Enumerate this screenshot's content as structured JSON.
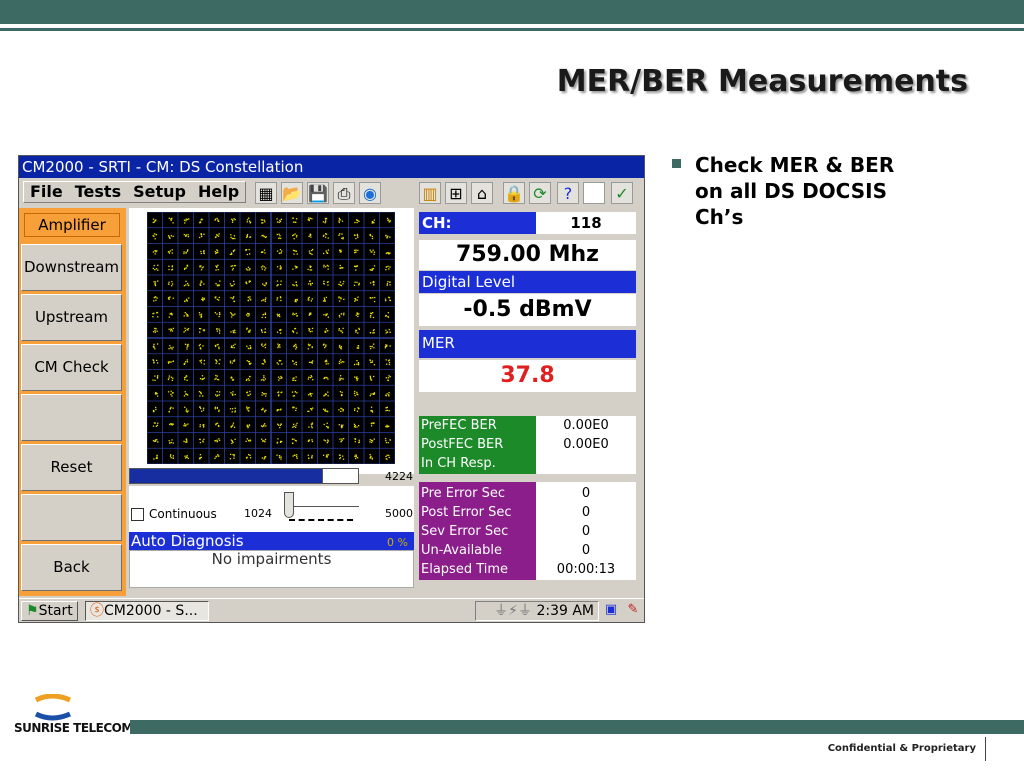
{
  "slide": {
    "title": "MER/BER Measurements",
    "bullets": [
      "Check MER & BER",
      "on all DS DOCSIS",
      "Ch’s"
    ],
    "footer": "Confidential & Proprietary",
    "logo_text": "SUNRISE TELECOM",
    "colors": {
      "accent": "#3d6b63",
      "device_blue": "#1c2fd6",
      "device_orange": "#f7a03a",
      "green": "#1d8a2a",
      "purple": "#8b1e8a",
      "mer_red": "#e02020"
    }
  },
  "device": {
    "window_title": "CM2000 - SRTI - CM: DS Constellation",
    "menu": [
      "File",
      "Tests",
      "Setup",
      "Help"
    ],
    "toolbar_icons": [
      "grid-icon",
      "folder-open-icon",
      "save-icon",
      "print-icon",
      "globe-icon",
      "chart-icon",
      "network-icon",
      "cable-icon",
      "lock-icon",
      "refresh-icon",
      "help-icon",
      "check-icon"
    ],
    "left_buttons": {
      "amplifier": "Amplifier",
      "downstream": "Downstream",
      "upstream": "Upstream",
      "cm_check": "CM Check",
      "blank1": "",
      "reset": "Reset",
      "blank2": "",
      "back": "Back"
    },
    "constellation": {
      "grid": 16,
      "progress_value": 4224,
      "progress_max": 5000
    },
    "controls": {
      "continuous_label": "Continuous",
      "continuous_checked": false,
      "slider_min": "1024",
      "slider_max": "5000",
      "progress_label": "4224"
    },
    "auto_diagnosis": {
      "title": "Auto Diagnosis",
      "percent": "0 %",
      "message": "No impairments"
    },
    "readout": {
      "ch_label": "CH:",
      "ch_value": "118",
      "frequency": "759.00 Mhz",
      "digital_level_label": "Digital Level",
      "digital_level_value": "-0.5 dBmV",
      "mer_label": "MER",
      "mer_value": "37.8"
    },
    "ber": [
      {
        "label": "PreFEC BER",
        "value": "0.00E0"
      },
      {
        "label": "PostFEC BER",
        "value": "0.00E0"
      },
      {
        "label": "In CH Resp.",
        "value": ""
      }
    ],
    "errors": [
      {
        "label": "Pre Error Sec",
        "value": "0"
      },
      {
        "label": "Post Error Sec",
        "value": "0"
      },
      {
        "label": "Sev Error Sec",
        "value": "0"
      },
      {
        "label": "Un-Available",
        "value": "0"
      },
      {
        "label": "Elapsed Time",
        "value": "00:00:13"
      }
    ],
    "taskbar": {
      "start": "Start",
      "task": "CM2000 - S...",
      "time": "2:39 AM"
    }
  }
}
